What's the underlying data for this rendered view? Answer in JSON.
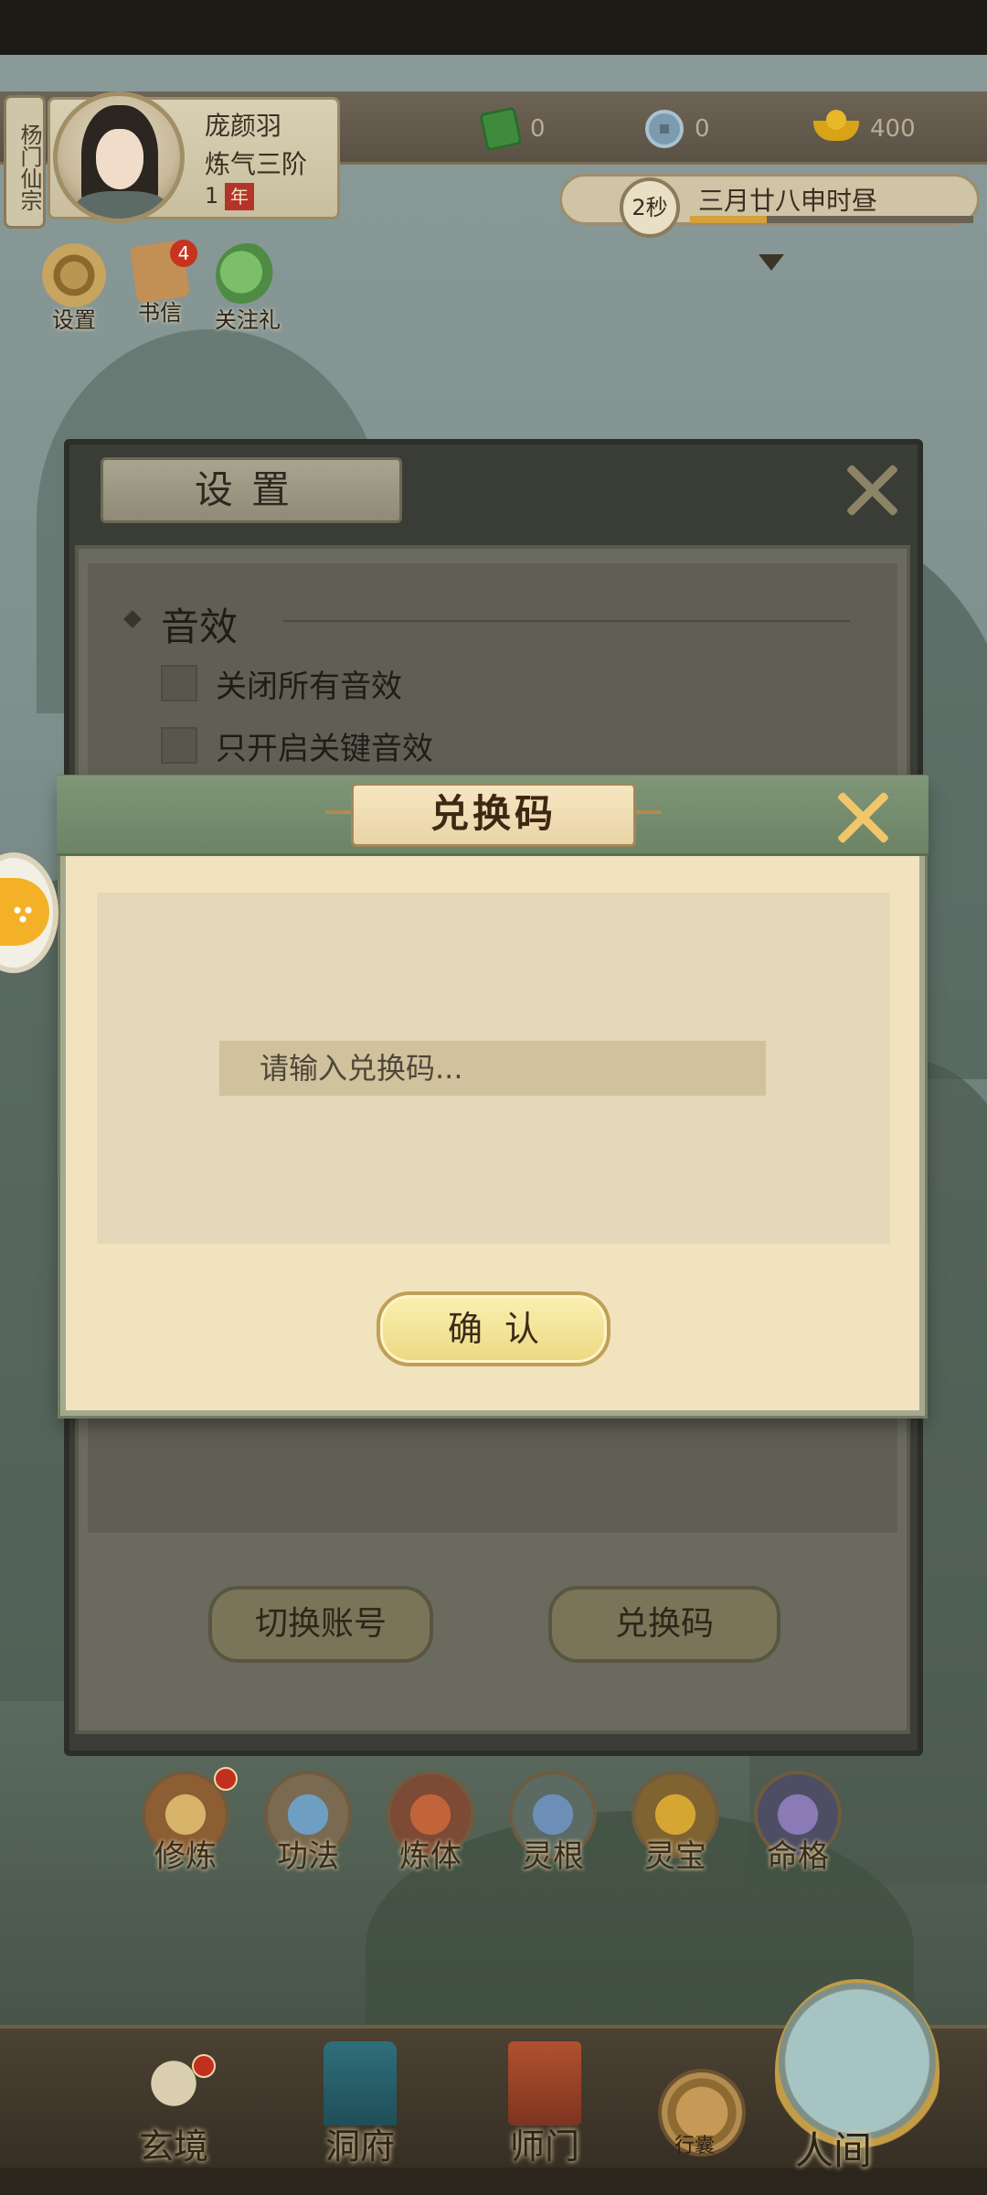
{
  "header": {
    "sect": "杨门仙宗",
    "player_name": "庞颜羽",
    "realm": "炼气三阶",
    "age_value": "1",
    "age_unit": "年"
  },
  "currencies": [
    {
      "icon": "jade-icon",
      "value": "0"
    },
    {
      "icon": "coin-icon",
      "value": "0"
    },
    {
      "icon": "gold-ingot-icon",
      "value": "400"
    }
  ],
  "time": {
    "seconds": "2秒",
    "date": "三月廿八申时昼",
    "progress": 0.27
  },
  "quick_buttons": [
    {
      "icon": "gear-icon",
      "label": "设置"
    },
    {
      "icon": "letter-icon",
      "label": "书信",
      "badge": "4"
    },
    {
      "icon": "gift-icon",
      "label": "关注礼"
    }
  ],
  "settings": {
    "title": "设置",
    "sound_section": "音效",
    "options": [
      "关闭所有音效",
      "只开启关键音效"
    ],
    "switch_account": "切换账号",
    "redeem_code": "兑换码"
  },
  "redeem_dialog": {
    "title": "兑换码",
    "input_placeholder": "请输入兑换码...",
    "input_value": "",
    "confirm": "确认"
  },
  "cultivation_menu": [
    {
      "icon": "meditation-icon",
      "label": "修炼",
      "has_dot": true
    },
    {
      "icon": "scroll-icon",
      "label": "功法"
    },
    {
      "icon": "cauldron-icon",
      "label": "炼体"
    },
    {
      "icon": "spirit-root-icon",
      "label": "灵根"
    },
    {
      "icon": "treasure-icon",
      "label": "灵宝"
    },
    {
      "icon": "fate-icon",
      "label": "命格"
    }
  ],
  "bottom_nav": [
    {
      "icon": "mystic-realm-icon",
      "label": "玄境",
      "has_dot": true
    },
    {
      "icon": "cave-icon",
      "label": "洞府"
    },
    {
      "icon": "sect-banner-icon",
      "label": "师门"
    },
    {
      "icon": "bag-icon",
      "label": "行囊"
    },
    {
      "icon": "mortal-world-icon",
      "label": "人间"
    }
  ],
  "colors": {
    "dialog_bg": "#f0e3bd",
    "header_green": "#7f9677",
    "confirm_gold": "#ecd882",
    "close_x": "#f1c66a"
  }
}
